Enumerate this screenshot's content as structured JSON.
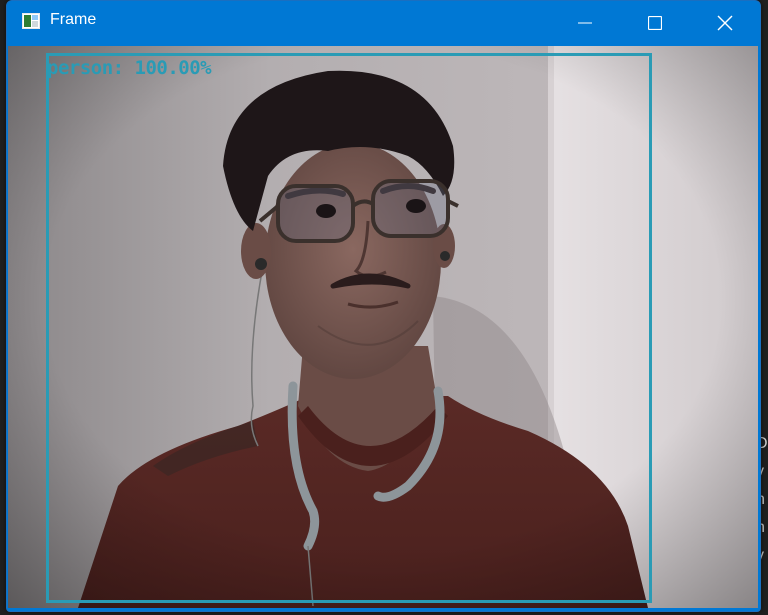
{
  "window": {
    "title": "Frame",
    "accent_color": "#0078d4",
    "controls": [
      "minimize-icon",
      "maximize-icon",
      "close-icon"
    ]
  },
  "video_frame": {
    "detection": {
      "label": "person: 100.00%",
      "box_color": "#2a9bb5"
    }
  },
  "background_page": {
    "partial_text": [
      "D",
      "v",
      "n",
      "h",
      "v"
    ]
  }
}
